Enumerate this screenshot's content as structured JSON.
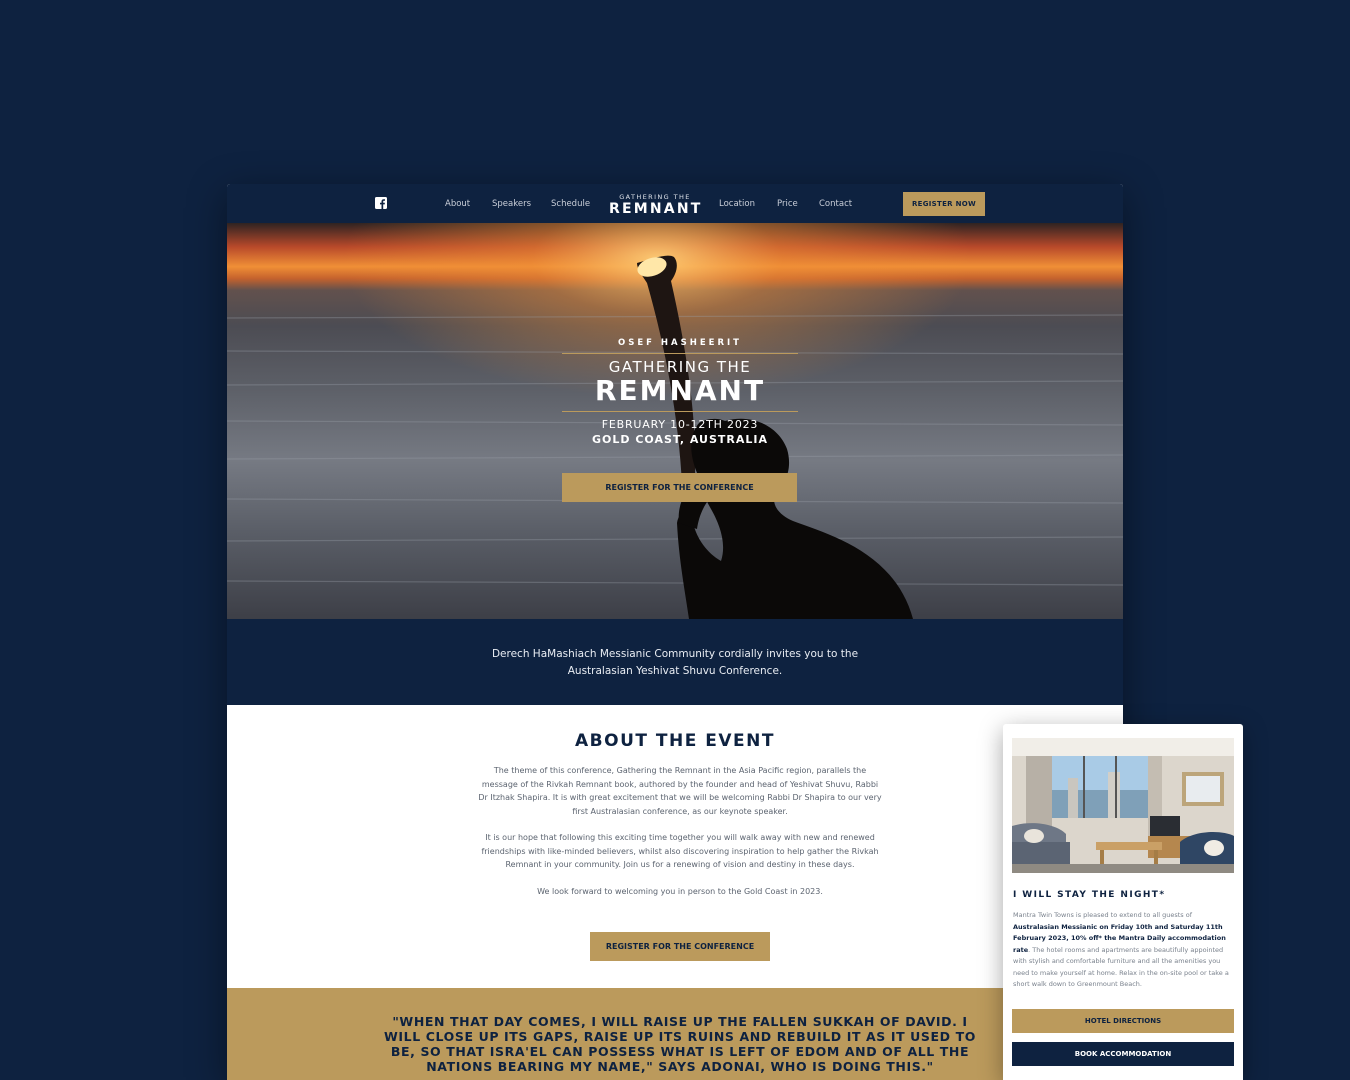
{
  "colors": {
    "navy": "#0e2240",
    "gold": "#bb9a5c",
    "white": "#ffffff"
  },
  "nav": {
    "social_icon": "facebook-icon",
    "links": [
      "About",
      "Speakers",
      "Schedule",
      "Location",
      "Price",
      "Contact"
    ],
    "logo_small": "GATHERING THE",
    "logo_big": "REMNANT",
    "register_label": "REGISTER NOW"
  },
  "hero": {
    "kicker": "OSEF HASHEERIT",
    "title_line1": "GATHERING THE",
    "title_line2": "REMNANT",
    "date": "FEBRUARY 10-12TH 2023",
    "location": "GOLD COAST, AUSTRALIA",
    "cta_label": "REGISTER FOR THE CONFERENCE"
  },
  "invite": {
    "line1": "Derech HaMashiach Messianic Community cordially invites you to the",
    "line2": "Australasian Yeshivat Shuvu Conference."
  },
  "about": {
    "heading": "ABOUT THE EVENT",
    "paragraphs": [
      "The theme of this conference, Gathering the Remnant in the Asia Pacific region, parallels the message of the Rivkah Remnant book, authored by the founder and head of Yeshivat Shuvu, Rabbi Dr Itzhak Shapira. It is with great excitement that we will be welcoming Rabbi Dr Shapira to our very first Australasian conference, as our keynote speaker.",
      "It is our hope that following this exciting time together you will walk away with new and renewed friendships with like-minded believers, whilst also discovering inspiration to help gather the Rivkah Remnant in your community. Join us for a renewing of vision and destiny in these days.",
      "We look forward to welcoming you in person to the Gold Coast in 2023."
    ],
    "cta_label": "REGISTER FOR THE CONFERENCE"
  },
  "quote": {
    "text": "\"WHEN THAT DAY COMES, I WILL RAISE UP THE FALLEN SUKKAH OF DAVID. I WILL CLOSE UP ITS GAPS, RAISE UP ITS RUINS AND REBUILD IT AS IT USED TO BE, SO THAT ISRA'EL CAN POSSESS WHAT IS LEFT OF EDOM AND OF ALL THE NATIONS BEARING MY NAME,\" SAYS ADONAI, WHO IS DOING THIS.\""
  },
  "accommodation": {
    "title": "I WILL STAY THE NIGHT*",
    "body_intro": "Mantra Twin Towns is pleased to extend to all guests of",
    "body_bold": "Australasian Messianic on Friday 10th and Saturday 11th February 2023, 10% off* the Mantra Daily accommodation rate",
    "body_rest": ". The hotel rooms and apartments are beautifully appointed with stylish and comfortable furniture and all the amenities you need to make yourself at home. Relax in the on-site pool or take a short walk down to Greenmount Beach.",
    "directions_label": "HOTEL DIRECTIONS",
    "book_label": "BOOK ACCOMMODATION"
  }
}
